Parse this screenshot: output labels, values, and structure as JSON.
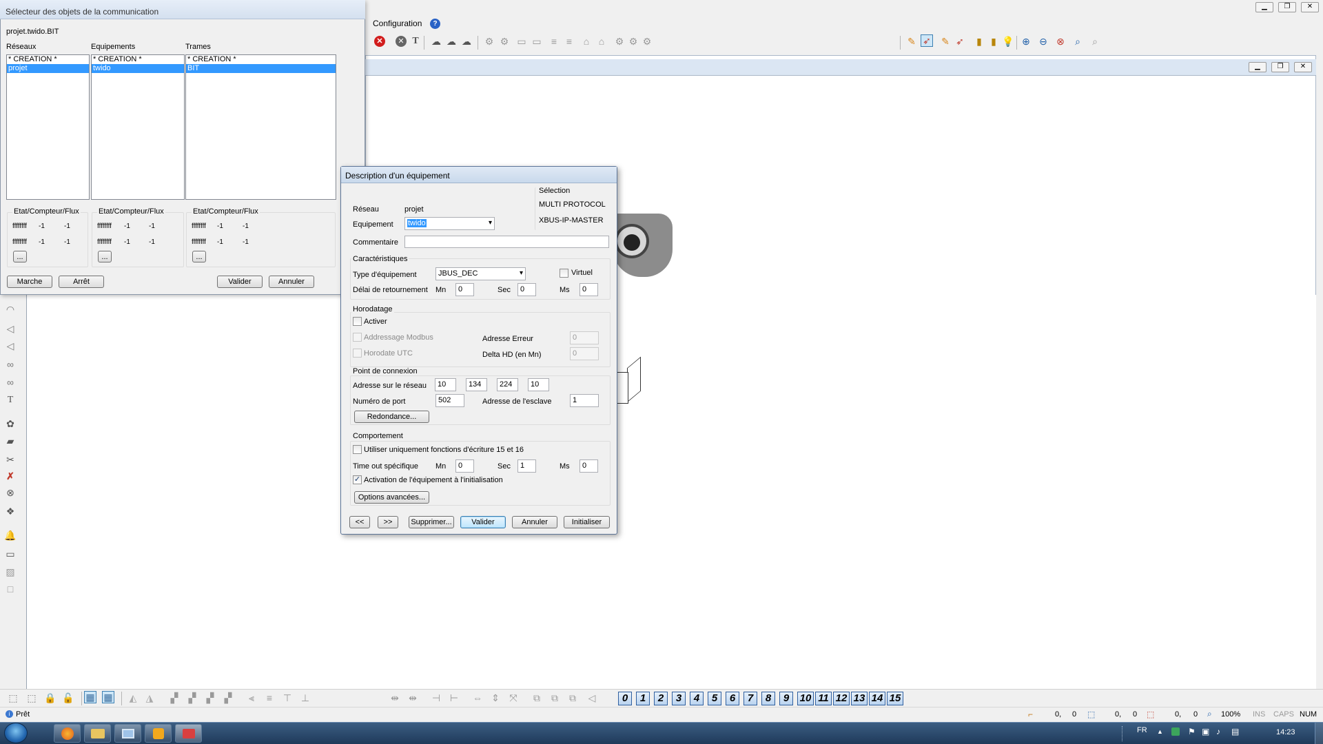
{
  "main": {
    "menu_configuration": "Configuration",
    "help_glyph": "?",
    "status_ready": "Prêt",
    "coords": [
      "0,",
      "0",
      "0,",
      "0",
      "0,",
      "0"
    ],
    "zoom": "100%",
    "ins": "INS",
    "caps": "CAPS",
    "num": "NUM",
    "layers": [
      "0",
      "1",
      "2",
      "3",
      "4",
      "5",
      "6",
      "7",
      "8",
      "9",
      "10",
      "11",
      "12",
      "13",
      "14",
      "15"
    ],
    "dropdown_glyph": "▾"
  },
  "selector": {
    "title": "Sélecteur des objets de la communication",
    "path": "projet.twido.BIT",
    "col_headers": [
      "Réseaux",
      "Equipements",
      "Trames"
    ],
    "lists": [
      [
        "* CREATION *",
        "projet"
      ],
      [
        "* CREATION *",
        "twido"
      ],
      [
        "* CREATION *",
        "BIT"
      ]
    ],
    "stats_header": "Etat/Compteur/Flux",
    "stats": [
      "ffffffff",
      "-1",
      "-1"
    ],
    "more_label": "...",
    "start": "Marche",
    "stop": "Arrêt",
    "validate": "Valider",
    "cancel": "Annuler"
  },
  "dialog": {
    "title": "Description d'un équipement",
    "network_label": "Réseau",
    "network_value": "projet",
    "selection_label": "Sélection",
    "selection_items": [
      "MULTI PROTOCOL",
      "XBUS-IP-MASTER"
    ],
    "equipment_label": "Equipement",
    "equipment_value": "twido",
    "comment_label": "Commentaire",
    "comment_value": "",
    "characteristics": "Caractéristiques",
    "type_label": "Type d'équipement",
    "type_value": "JBUS_DEC",
    "virtual_label": "Virtuel",
    "delay_label": "Délai de retournement",
    "mn": "Mn",
    "sec": "Sec",
    "ms": "Ms",
    "delay_values": [
      "0",
      "0",
      "0"
    ],
    "timestamp_group": "Horodatage",
    "activate": "Activer",
    "modbus": "Addressage Modbus",
    "utc": "Horodate UTC",
    "error_addr_label": "Adresse Erreur",
    "error_addr_value": "0",
    "delta_label": "Delta HD (en Mn)",
    "delta_value": "0",
    "connection_group": "Point de connexion",
    "net_addr_label": "Adresse sur le réseau",
    "ip": [
      "10",
      "134",
      "224",
      "10"
    ],
    "port_label": "Numéro de port",
    "port_value": "502",
    "slave_label": "Adresse de l'esclave",
    "slave_value": "1",
    "redundancy": "Redondance...",
    "behavior_group": "Comportement",
    "write_only_label": "Utiliser uniquement fonctions d'écriture 15 et 16",
    "timeout_label": "Time out spécifique",
    "timeout_values": [
      "0",
      "1",
      "0"
    ],
    "init_label": "Activation de l'équipement à l'initialisation",
    "init_checked": "✓",
    "advanced": "Options avancées...",
    "prev": "<<",
    "next": ">>",
    "delete": "Supprimer...",
    "validate": "Valider",
    "cancel": "Annuler",
    "initialize": "Initialiser"
  },
  "taskbar": {
    "lang": "FR",
    "time": "14:23"
  },
  "colors": {
    "selection": "#3399ff",
    "taskbar": "#2b4c6f",
    "title_bar": "#dbe6f3"
  }
}
